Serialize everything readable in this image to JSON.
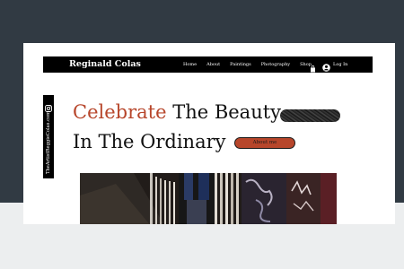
{
  "site": {
    "brand": "Reginald Colas"
  },
  "nav": {
    "items": [
      {
        "label": "Home"
      },
      {
        "label": "About"
      },
      {
        "label": "Paintings"
      },
      {
        "label": "Photography"
      },
      {
        "label": "Shop"
      }
    ],
    "login_label": "Log In"
  },
  "side": {
    "email": "TheArtistReggieColas.com"
  },
  "hero": {
    "headline_accent": "Celebrate",
    "headline_rest": " The Beauty",
    "headline_line2": "In The Ordinary",
    "cta_label": "About me"
  },
  "colors": {
    "accent": "#b7462b",
    "navbar": "#000000",
    "backdrop": "#313a43"
  },
  "icons": [
    "instagram-icon",
    "cart-icon",
    "user-icon"
  ]
}
